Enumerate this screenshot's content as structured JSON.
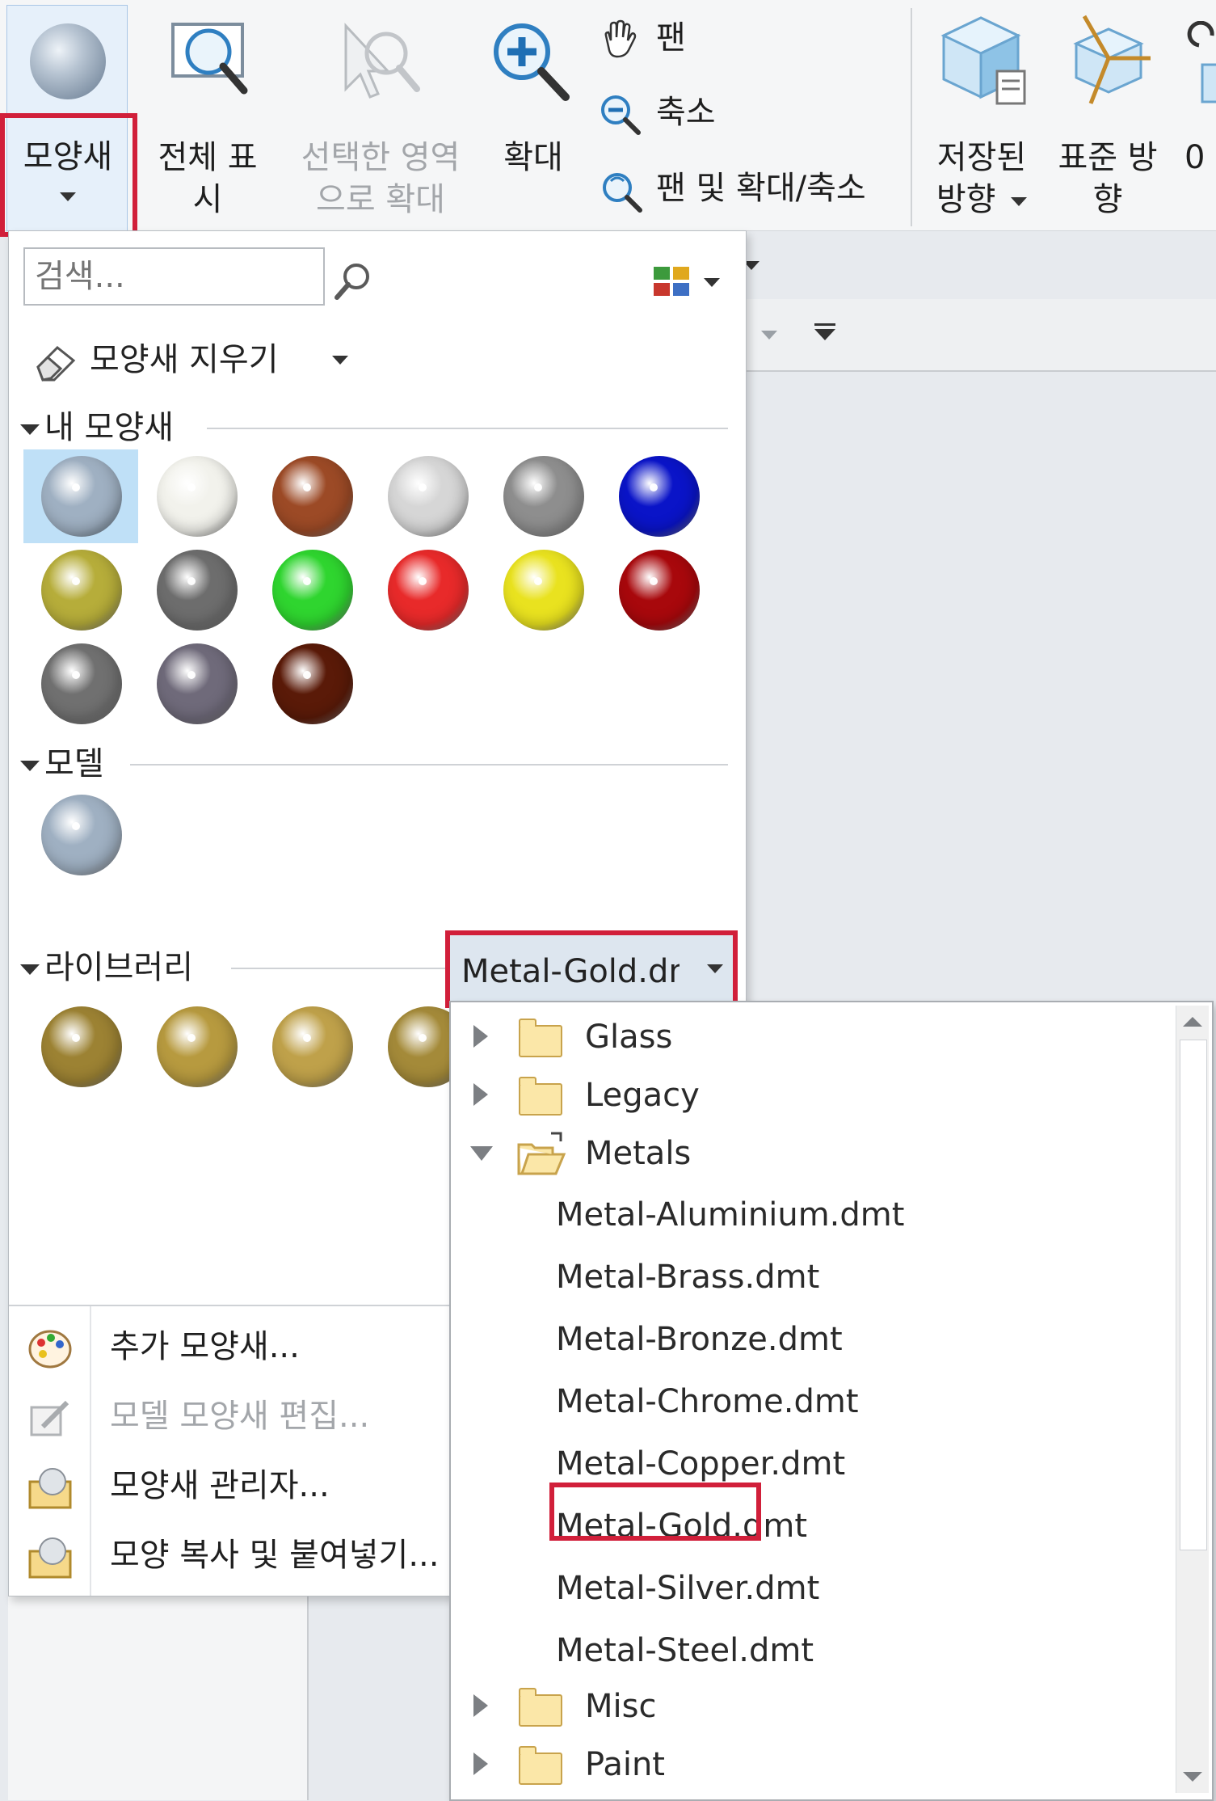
{
  "ribbon": {
    "appearance_label": "모양새",
    "zoom_all_line1": "전체 표",
    "zoom_all_line2": "시",
    "zoom_area_line1": "선택한 영역",
    "zoom_area_line2": "으로 확대",
    "zoom_in_label": "확대",
    "pan_label": "팬",
    "zoom_out_label": "축소",
    "pan_zoom_label": "팬 및 확대/축소",
    "saved_orient_line1": "저장된",
    "saved_orient_line2": "방향",
    "std_orient_line1": "표준 방",
    "std_orient_line2": "향",
    "cut_off_label": "0"
  },
  "panel": {
    "search_placeholder": "검색...",
    "clear_appearance_label": "모양새 지우기",
    "my_appearances_header": "내 모양새",
    "model_header": "모델",
    "library_header": "라이브러리",
    "library_selected": "Metal-Gold.dm",
    "menu": [
      {
        "label": "추가 모양새...",
        "icon": "palette-icon"
      },
      {
        "label": "모델 모양새 편집...",
        "icon": "edit-appearance-icon"
      },
      {
        "label": "모양새 관리자...",
        "icon": "appearance-manager-icon"
      },
      {
        "label": "모양 복사 및 붙여넣기...",
        "icon": "copy-paste-appearance-icon"
      }
    ]
  },
  "swatches": {
    "my": [
      "#9fb0c2",
      "#f2f2ec",
      "#9c4a26",
      "#d6d6d6",
      "#8e8e8e",
      "#0a14c8",
      "#b6ad3a",
      "#6d6d6d",
      "#2fd52f",
      "#e82a2a",
      "#e9e21f",
      "#a8080c",
      "#707070",
      "#6f6a7a",
      "#5a1a08"
    ],
    "model": [
      "#9fb0c2"
    ],
    "library": [
      "#9c8233",
      "#b79a3f",
      "#bfa14a",
      "#a48a39"
    ]
  },
  "tree": {
    "folders_top": [
      "Glass",
      "Legacy"
    ],
    "open_folder": "Metals",
    "files": [
      "Metal-Aluminium.dmt",
      "Metal-Brass.dmt",
      "Metal-Bronze.dmt",
      "Metal-Chrome.dmt",
      "Metal-Copper.dmt",
      "Metal-Gold.dmt",
      "Metal-Silver.dmt",
      "Metal-Steel.dmt"
    ],
    "folders_bottom": [
      "Misc",
      "Paint"
    ]
  }
}
